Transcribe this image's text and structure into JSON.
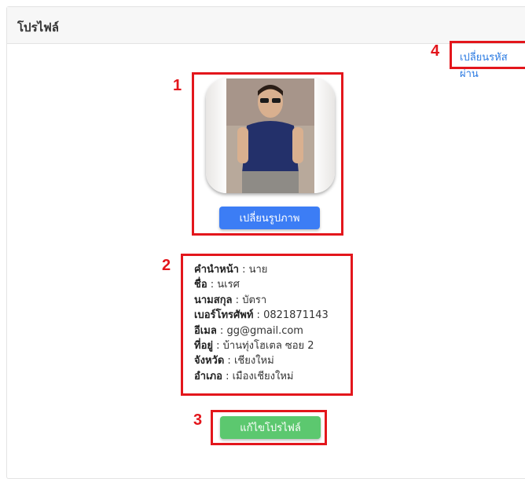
{
  "header": {
    "title": "โปรไฟล์"
  },
  "links": {
    "change_password": "เปลี่ยนรหัสผ่าน"
  },
  "profile": {
    "change_photo_label": "เปลี่ยนรูปภาพ",
    "edit_profile_label": "แก้ไขโปรไฟล์",
    "fields": [
      {
        "label": "คำนำหน้า",
        "value": "นาย"
      },
      {
        "label": "ชื่อ",
        "value": "นเรศ"
      },
      {
        "label": "นามสกุล",
        "value": "บัตรา"
      },
      {
        "label": "เบอร์โทรศัพท์",
        "value": "0821871143"
      },
      {
        "label": "อีเมล",
        "value": "gg@gmail.com"
      },
      {
        "label": "ที่อยู่",
        "value": "บ้านทุ่งโฮเตล ซอย 2"
      },
      {
        "label": "จังหวัด",
        "value": "เชียงใหม่"
      },
      {
        "label": "อำเภอ",
        "value": "เมืองเชียงใหม่"
      }
    ],
    "separator": " : "
  },
  "annotations": [
    "1",
    "2",
    "3",
    "4"
  ],
  "colors": {
    "annotation": "#e3161c",
    "primary_button": "#3c7df5",
    "success_button": "#5cc86f",
    "link": "#2a7ae2"
  }
}
